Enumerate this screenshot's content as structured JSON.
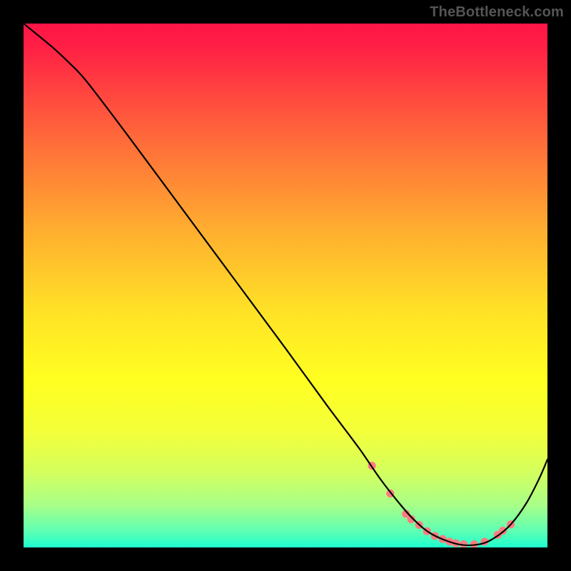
{
  "watermark": "TheBottleneck.com",
  "chart_data": {
    "type": "line",
    "title": "",
    "xlabel": "",
    "ylabel": "",
    "xlim": [
      0,
      100
    ],
    "ylim": [
      0,
      100
    ],
    "grid": false,
    "background_gradient": {
      "from_top": [
        {
          "t": 0.0,
          "color": "#ff1547"
        },
        {
          "t": 0.04,
          "color": "#ff1e45"
        },
        {
          "t": 0.22,
          "color": "#ff6a3a"
        },
        {
          "t": 0.4,
          "color": "#ffb02f"
        },
        {
          "t": 0.55,
          "color": "#ffe227"
        },
        {
          "t": 0.68,
          "color": "#ffff20"
        },
        {
          "t": 0.78,
          "color": "#f3ff3a"
        },
        {
          "t": 0.86,
          "color": "#d2ff60"
        },
        {
          "t": 0.92,
          "color": "#a7ff88"
        },
        {
          "t": 0.97,
          "color": "#5cffb4"
        },
        {
          "t": 1.0,
          "color": "#1dffd0"
        }
      ]
    },
    "series": [
      {
        "name": "bottleneck-curve",
        "stroke": "#000000",
        "stroke_width": 2.2,
        "x": [
          0.0,
          5.5,
          8.5,
          12.0,
          20.0,
          30.0,
          40.0,
          50.0,
          58.0,
          64.0,
          68.0,
          71.5,
          74.5,
          78.0,
          83.0,
          87.0,
          90.0,
          93.0,
          96.0,
          98.5,
          100.0
        ],
        "y": [
          100.0,
          95.5,
          92.7,
          89.0,
          78.5,
          65.0,
          51.5,
          38.0,
          27.0,
          19.0,
          13.2,
          8.7,
          5.3,
          2.5,
          0.6,
          0.6,
          1.9,
          4.4,
          8.5,
          13.3,
          16.8
        ]
      }
    ],
    "markers": {
      "name": "highlight-dots",
      "color": "#ff7b7f",
      "radius": 5.6,
      "x": [
        66.5,
        70.0,
        73.0,
        74.0,
        75.5,
        77.0,
        78.5,
        80.0,
        81.3,
        82.5,
        84.0,
        86.0,
        88.0,
        90.5,
        91.5,
        93.0
      ],
      "y": [
        15.6,
        10.3,
        6.4,
        5.4,
        4.3,
        3.1,
        2.2,
        1.6,
        1.1,
        0.8,
        0.6,
        0.6,
        1.1,
        2.4,
        3.2,
        4.4
      ]
    }
  }
}
